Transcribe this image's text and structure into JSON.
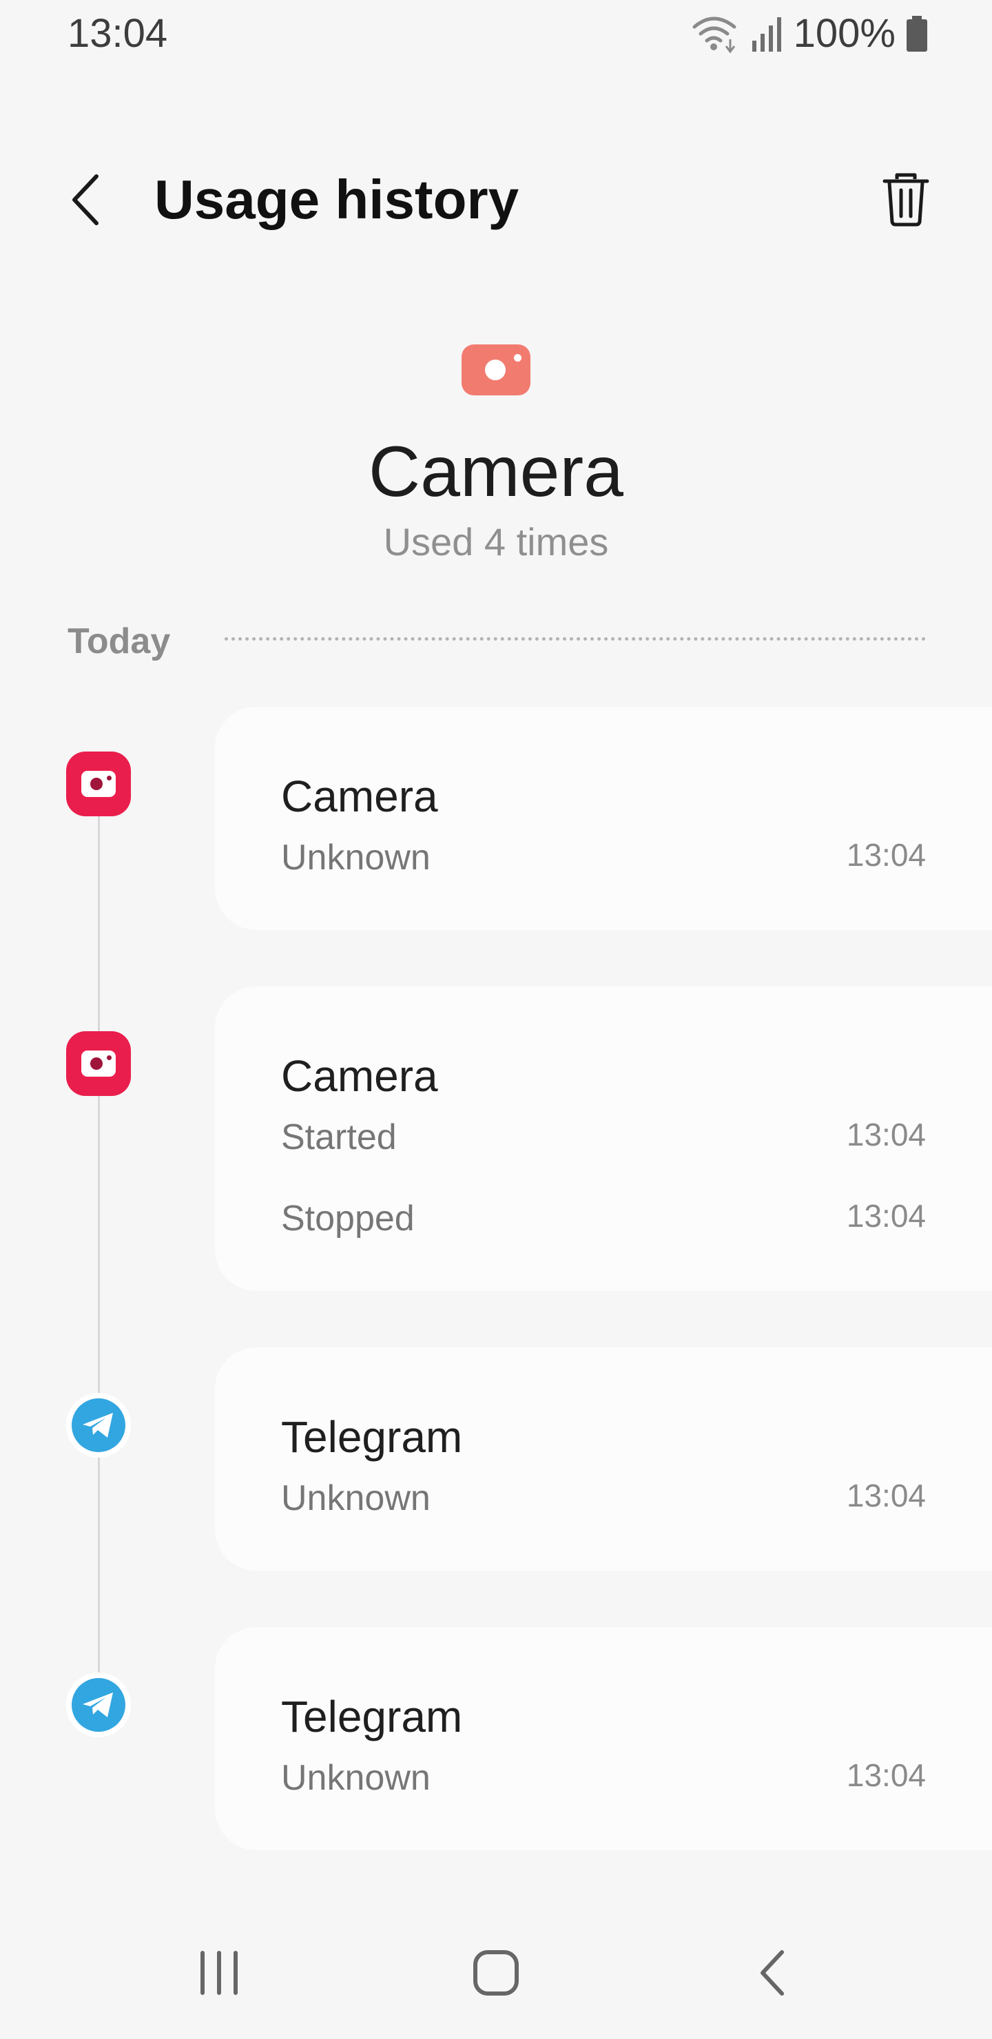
{
  "status_bar": {
    "time": "13:04",
    "battery_percent": "100%",
    "icons": [
      "wifi-icon",
      "signal-icon",
      "battery-icon"
    ]
  },
  "header": {
    "title": "Usage history",
    "back_icon": "back-arrow-icon",
    "delete_icon": "trash-icon"
  },
  "app": {
    "name": "Camera",
    "usage_summary": "Used 4 times",
    "icon": "camera-icon",
    "icon_color": "#f27b70"
  },
  "section": {
    "label": "Today"
  },
  "entries": [
    {
      "app": "Camera",
      "icon": "camera-icon",
      "rows": [
        {
          "label": "Unknown",
          "time": "13:04"
        }
      ]
    },
    {
      "app": "Camera",
      "icon": "camera-icon",
      "rows": [
        {
          "label": "Started",
          "time": "13:04"
        },
        {
          "label": "Stopped",
          "time": "13:04"
        }
      ]
    },
    {
      "app": "Telegram",
      "icon": "telegram-icon",
      "rows": [
        {
          "label": "Unknown",
          "time": "13:04"
        }
      ]
    },
    {
      "app": "Telegram",
      "icon": "telegram-icon",
      "rows": [
        {
          "label": "Unknown",
          "time": "13:04"
        }
      ]
    }
  ],
  "colors": {
    "camera_badge": "#ea1e4c",
    "telegram_badge": "#32a6e0",
    "background": "#f6f6f6",
    "card": "#fcfcfc"
  },
  "nav_bar": {
    "buttons": [
      "recent-apps-icon",
      "home-icon",
      "back-icon"
    ]
  }
}
